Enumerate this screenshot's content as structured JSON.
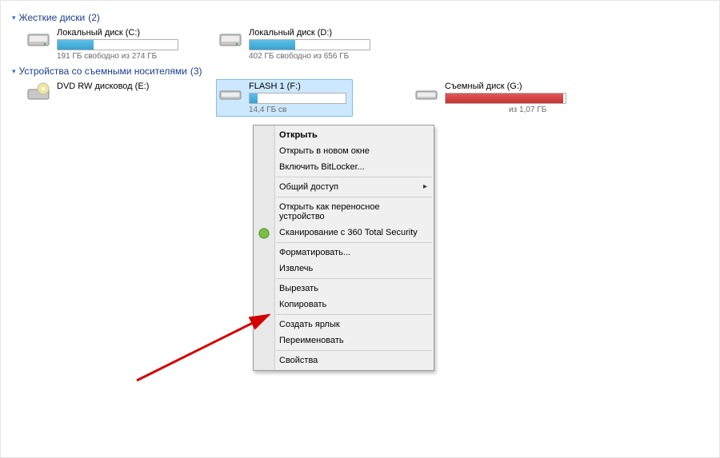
{
  "groups": {
    "hdd": {
      "label": "Жесткие диски",
      "count": "(2)"
    },
    "removable": {
      "label": "Устройства со съемными носителями",
      "count": "(3)"
    }
  },
  "hdd_drives": [
    {
      "name": "Локальный диск (C:)",
      "sub": "191 ГБ свободно из 274 ГБ",
      "fill": 30,
      "red": false
    },
    {
      "name": "Локальный диск (D:)",
      "sub": "402 ГБ свободно из 656 ГБ",
      "fill": 38,
      "red": false
    }
  ],
  "rem_drives": {
    "dvd": {
      "name": "DVD RW дисковод (E:)"
    },
    "flash": {
      "name": "FLASH 1 (F:)",
      "sub_prefix": "14,4 ГБ св",
      "fill": 8,
      "red": false
    },
    "gdisk": {
      "name": "Съемный диск (G:)",
      "sub_suffix": " из 1,07 ГБ",
      "fill": 98,
      "red": true
    }
  },
  "menu": {
    "open": "Открыть",
    "open_new": "Открыть в новом окне",
    "bitlocker": "Включить BitLocker...",
    "share": "Общий доступ",
    "portable": "Открыть как переносное устройство",
    "scan": "Сканирование с 360 Total Security",
    "format": "Форматировать...",
    "eject": "Извлечь",
    "cut": "Вырезать",
    "copy": "Копировать",
    "shortcut": "Создать ярлык",
    "rename": "Переименовать",
    "properties": "Свойства"
  }
}
